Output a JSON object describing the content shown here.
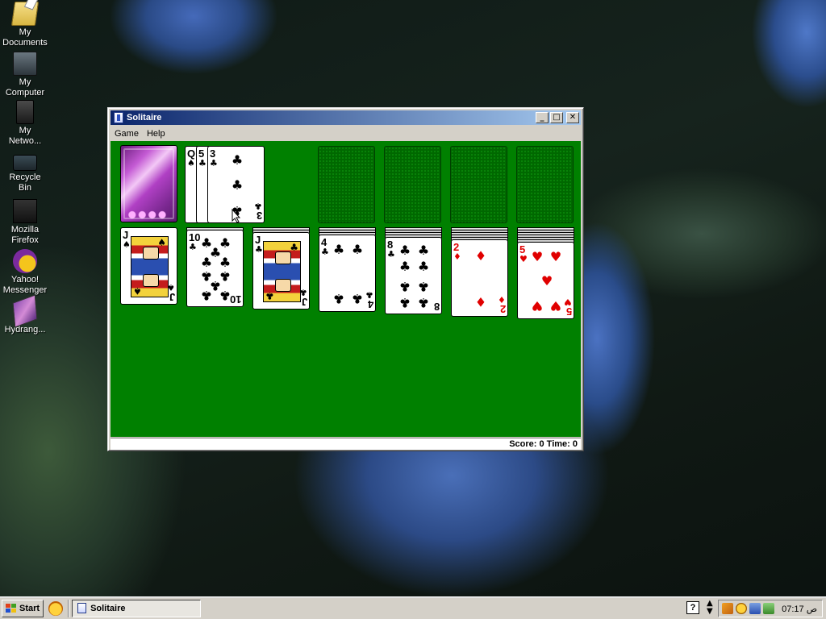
{
  "desktop": {
    "icons": [
      {
        "label_lines": [
          "My",
          "Documents"
        ],
        "icon": "my-documents-icon"
      },
      {
        "label_lines": [
          "My",
          "Computer"
        ],
        "icon": "my-computer-icon"
      },
      {
        "label_lines": [
          "My",
          "Netwo..."
        ],
        "icon": "network-icon"
      },
      {
        "label_lines": [
          "Recycle",
          "Bin"
        ],
        "icon": "recycle-bin-icon"
      },
      {
        "label_lines": [
          "Mozilla",
          "Firefox"
        ],
        "icon": "firefox-icon"
      },
      {
        "label_lines": [
          "Yahoo!",
          "Messenger"
        ],
        "icon": "yahoo-messenger-icon"
      },
      {
        "label_lines": [
          "Hydrang..."
        ],
        "icon": "hydrangea-file-icon"
      }
    ]
  },
  "window": {
    "title": "Solitaire",
    "buttons": {
      "minimize": "_",
      "maximize": "□",
      "close": "✕"
    },
    "menu": [
      "Game",
      "Help"
    ],
    "status": "Score: 0 Time: 0"
  },
  "game": {
    "stock": {
      "face_down": true
    },
    "waste": [
      {
        "rank": "Q",
        "suit": "♠",
        "color": "black"
      },
      {
        "rank": "5",
        "suit": "♣",
        "color": "black"
      },
      {
        "rank": "3",
        "suit": "♣",
        "color": "black"
      }
    ],
    "foundations": 4,
    "tableau": [
      {
        "hidden": 0,
        "card": {
          "rank": "J",
          "suit": "♠",
          "color": "black",
          "face": true
        }
      },
      {
        "hidden": 1,
        "card": {
          "rank": "10",
          "suit": "♣",
          "color": "black",
          "face": false
        }
      },
      {
        "hidden": 2,
        "card": {
          "rank": "J",
          "suit": "♣",
          "color": "black",
          "face": true
        }
      },
      {
        "hidden": 3,
        "card": {
          "rank": "4",
          "suit": "♣",
          "color": "black",
          "face": false
        }
      },
      {
        "hidden": 4,
        "card": {
          "rank": "8",
          "suit": "♣",
          "color": "black",
          "face": false
        }
      },
      {
        "hidden": 5,
        "card": {
          "rank": "2",
          "suit": "♦",
          "color": "red",
          "face": false
        }
      },
      {
        "hidden": 6,
        "card": {
          "rank": "5",
          "suit": "♥",
          "color": "red",
          "face": false
        }
      }
    ]
  },
  "taskbar": {
    "start_label": "Start",
    "task_label": "Solitaire",
    "help_glyph": "?",
    "clock": "07:17 ص"
  },
  "colors": {
    "felt": "#008000",
    "title_start": "#0a246a",
    "title_end": "#a6caf0",
    "card_red": "#e00000"
  }
}
